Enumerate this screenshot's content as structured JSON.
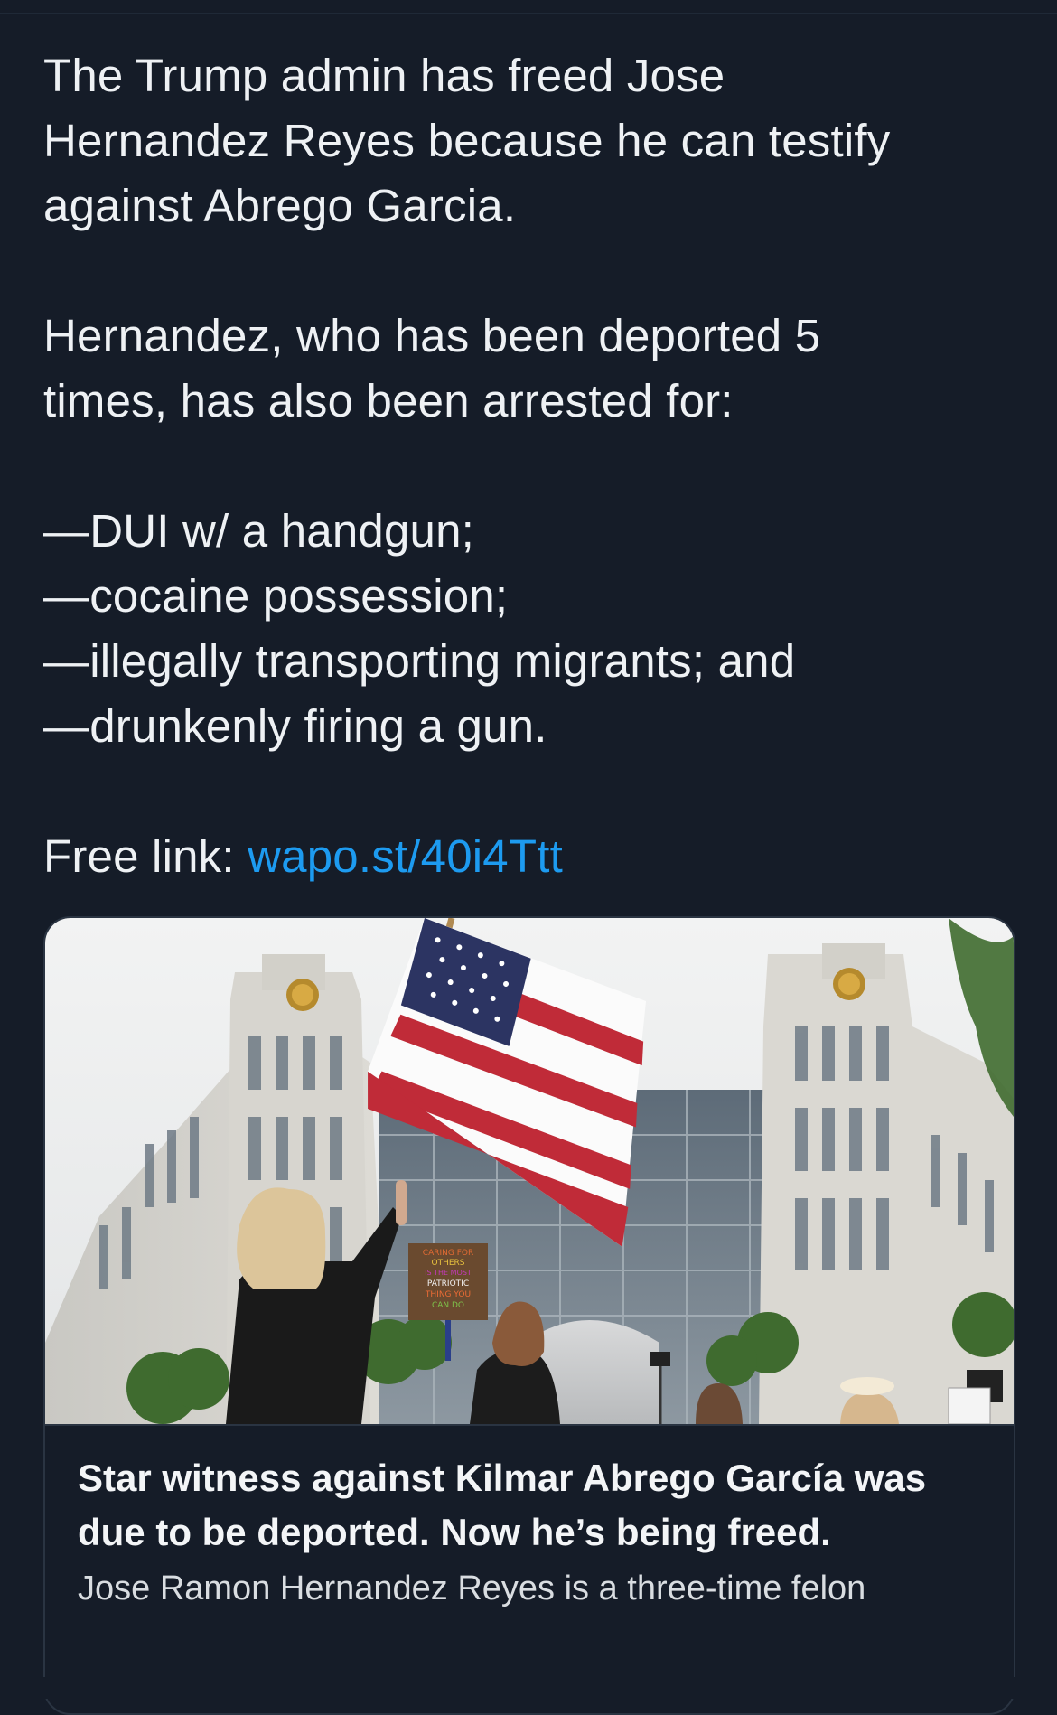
{
  "post": {
    "paragraphs": [
      [
        "The Trump admin has freed Jose",
        "Hernandez Reyes because he can testify",
        "against Abrego Garcia."
      ],
      [
        "Hernandez, who has been deported 5",
        "times, has also been arrested for:"
      ],
      [
        "—DUI w/ a handgun;",
        "—cocaine possession;",
        "—illegally transporting migrants; and",
        "—drunkenly firing a gun."
      ]
    ],
    "free_link_label": "Free link: ",
    "free_link_url": "wapo.st/40i4Ttt"
  },
  "card": {
    "sign_lines": [
      "CARING FOR",
      "OTHERS",
      "IS THE MOST",
      "PATRIOTIC",
      "THING YOU",
      "CAN DO"
    ],
    "title": "Star witness against Kilmar Abrego García was due to be deported. Now he’s being freed.",
    "description": "Jose Ramon Hernandez Reyes is a three-time felon"
  },
  "colors": {
    "background": "#151c28",
    "text": "#eef1f4",
    "link": "#1d9bf0",
    "card_border": "#2a3442"
  }
}
